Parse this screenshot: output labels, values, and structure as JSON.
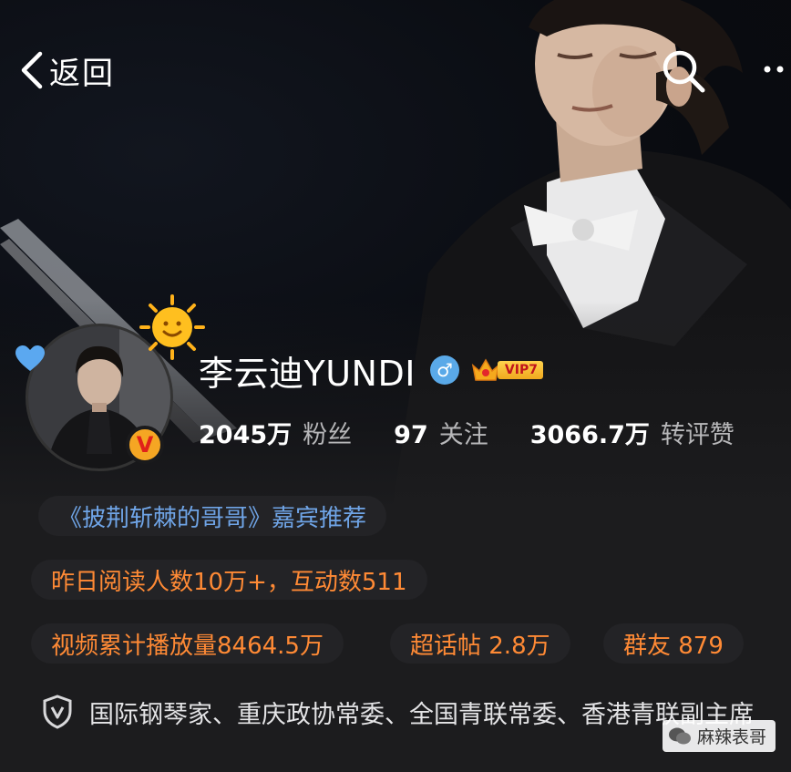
{
  "nav": {
    "back_label": "返回"
  },
  "profile": {
    "name": "李云迪YUNDI",
    "gender": "♂",
    "vip_label": "VIP7",
    "verified_mark": "V",
    "stats": [
      {
        "value": "2045万",
        "label": "粉丝"
      },
      {
        "value": "97",
        "label": "关注"
      },
      {
        "value": "3066.7万",
        "label": "转评赞"
      }
    ]
  },
  "tags": {
    "guest": "《披荆斩棘的哥哥》嘉宾推荐",
    "reads": "昨日阅读人数10万+，互动数511",
    "video": "视频累计播放量8464.5万",
    "super_topic": "超话帖 2.8万",
    "group": "群友 879"
  },
  "description": "国际钢琴家、重庆政协常委、全国青联常委、香港青联副主席",
  "watermark": "麻辣表哥",
  "colors": {
    "accent_orange": "#ff8a35",
    "link_blue": "#6fa4e6",
    "background": "#1c1c1e",
    "gender_blue": "#5aa9e8",
    "vip_gold": "#f0a91e"
  },
  "icons": {
    "back": "chevron-left-icon",
    "search": "search-icon",
    "more": "more-icon",
    "sun": "sun-icon",
    "heart": "heart-icon",
    "gender": "male-gender-icon",
    "vip": "crown-icon",
    "shield": "shield-icon"
  }
}
